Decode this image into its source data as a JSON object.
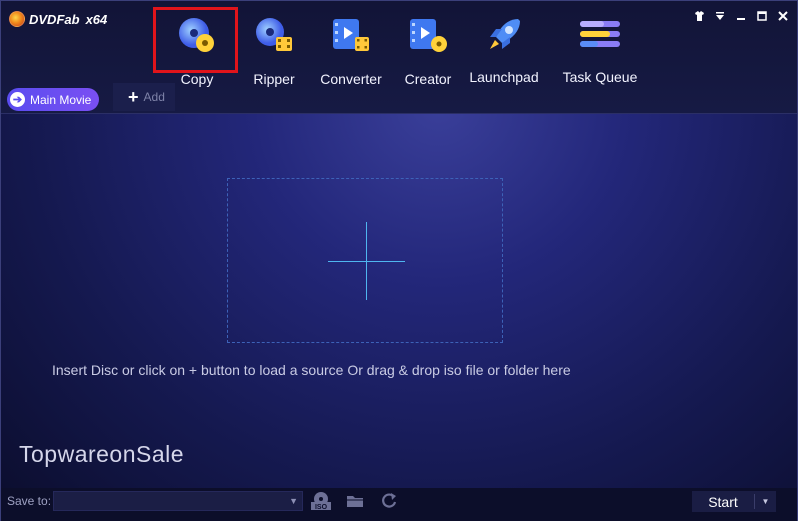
{
  "app": {
    "name": "DVDFab",
    "arch": "x64"
  },
  "nav": {
    "items": [
      {
        "label": "Copy",
        "icon": "copy-disc-icon"
      },
      {
        "label": "Ripper",
        "icon": "ripper-icon"
      },
      {
        "label": "Converter",
        "icon": "converter-icon"
      },
      {
        "label": "Creator",
        "icon": "creator-icon"
      },
      {
        "label": "Launchpad",
        "icon": "rocket-icon"
      },
      {
        "label": "Task Queue",
        "icon": "task-queue-icon"
      }
    ],
    "selected": "Copy"
  },
  "subbar": {
    "main_movie_label": "Main Movie",
    "add_label": "Add"
  },
  "main": {
    "hint": "Insert Disc or click on + button to load a source Or drag & drop iso file or folder here"
  },
  "watermark": "TopwareonSale",
  "bottom": {
    "save_to_label": "Save to:",
    "save_to_value": "",
    "start_label": "Start"
  },
  "colors": {
    "accent": "#5a4cf0",
    "selection_border": "#e0141b",
    "cross": "#4fb6f0"
  }
}
